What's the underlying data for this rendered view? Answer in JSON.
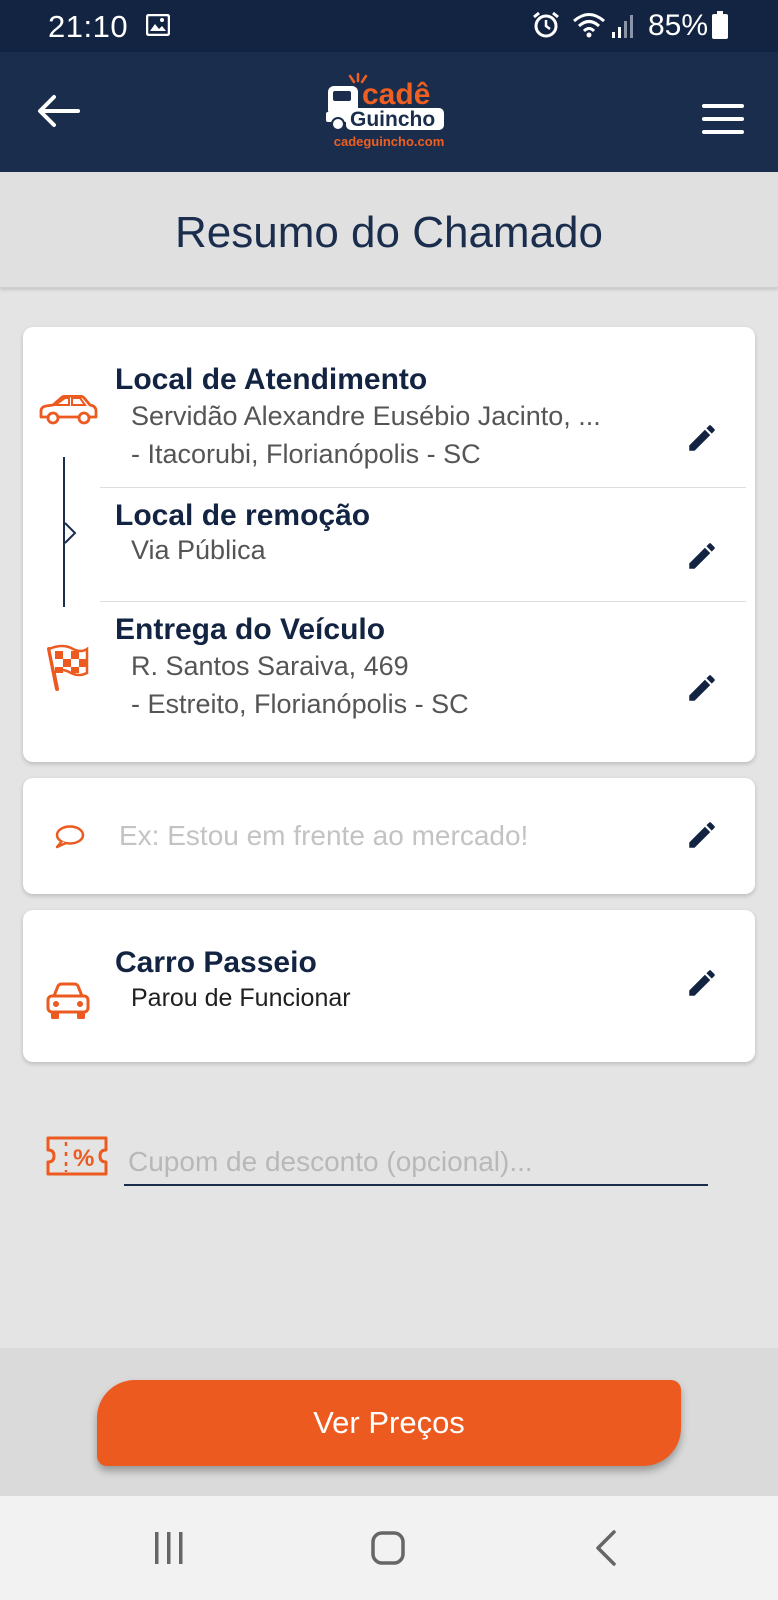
{
  "status_bar": {
    "time": "21:10",
    "battery": "85%",
    "icons": [
      "image-icon",
      "alarm-icon",
      "wifi-icon",
      "signal-icon",
      "battery-icon"
    ]
  },
  "app_bar": {
    "logo_text": "Cadê Guincho",
    "logo_url": "cadeguincho.com",
    "icons": [
      "back-arrow-icon",
      "hamburger-menu-icon"
    ]
  },
  "page": {
    "title": "Resumo do Chamado"
  },
  "route": {
    "pickup": {
      "title": "Local de Atendimento",
      "line1": "Servidão Alexandre Eusébio Jacinto, ...",
      "line2": "- Itacorubi, Florianópolis - SC"
    },
    "removal": {
      "title": "Local de remoção",
      "line1": "Via Pública"
    },
    "delivery": {
      "title": "Entrega do Veículo",
      "line1": "R. Santos Saraiva, 469",
      "line2": "- Estreito, Florianópolis - SC"
    }
  },
  "note": {
    "placeholder": "Ex: Estou em frente ao mercado!"
  },
  "vehicle": {
    "type": "Carro Passeio",
    "problem": "Parou de Funcionar"
  },
  "coupon": {
    "placeholder": "Cupom de desconto (opcional)...",
    "value": ""
  },
  "cta": {
    "label": "Ver Preços"
  },
  "colors": {
    "navy": "#1a2d4d",
    "accent": "#ec5a1f",
    "background": "#e4e4e4"
  }
}
